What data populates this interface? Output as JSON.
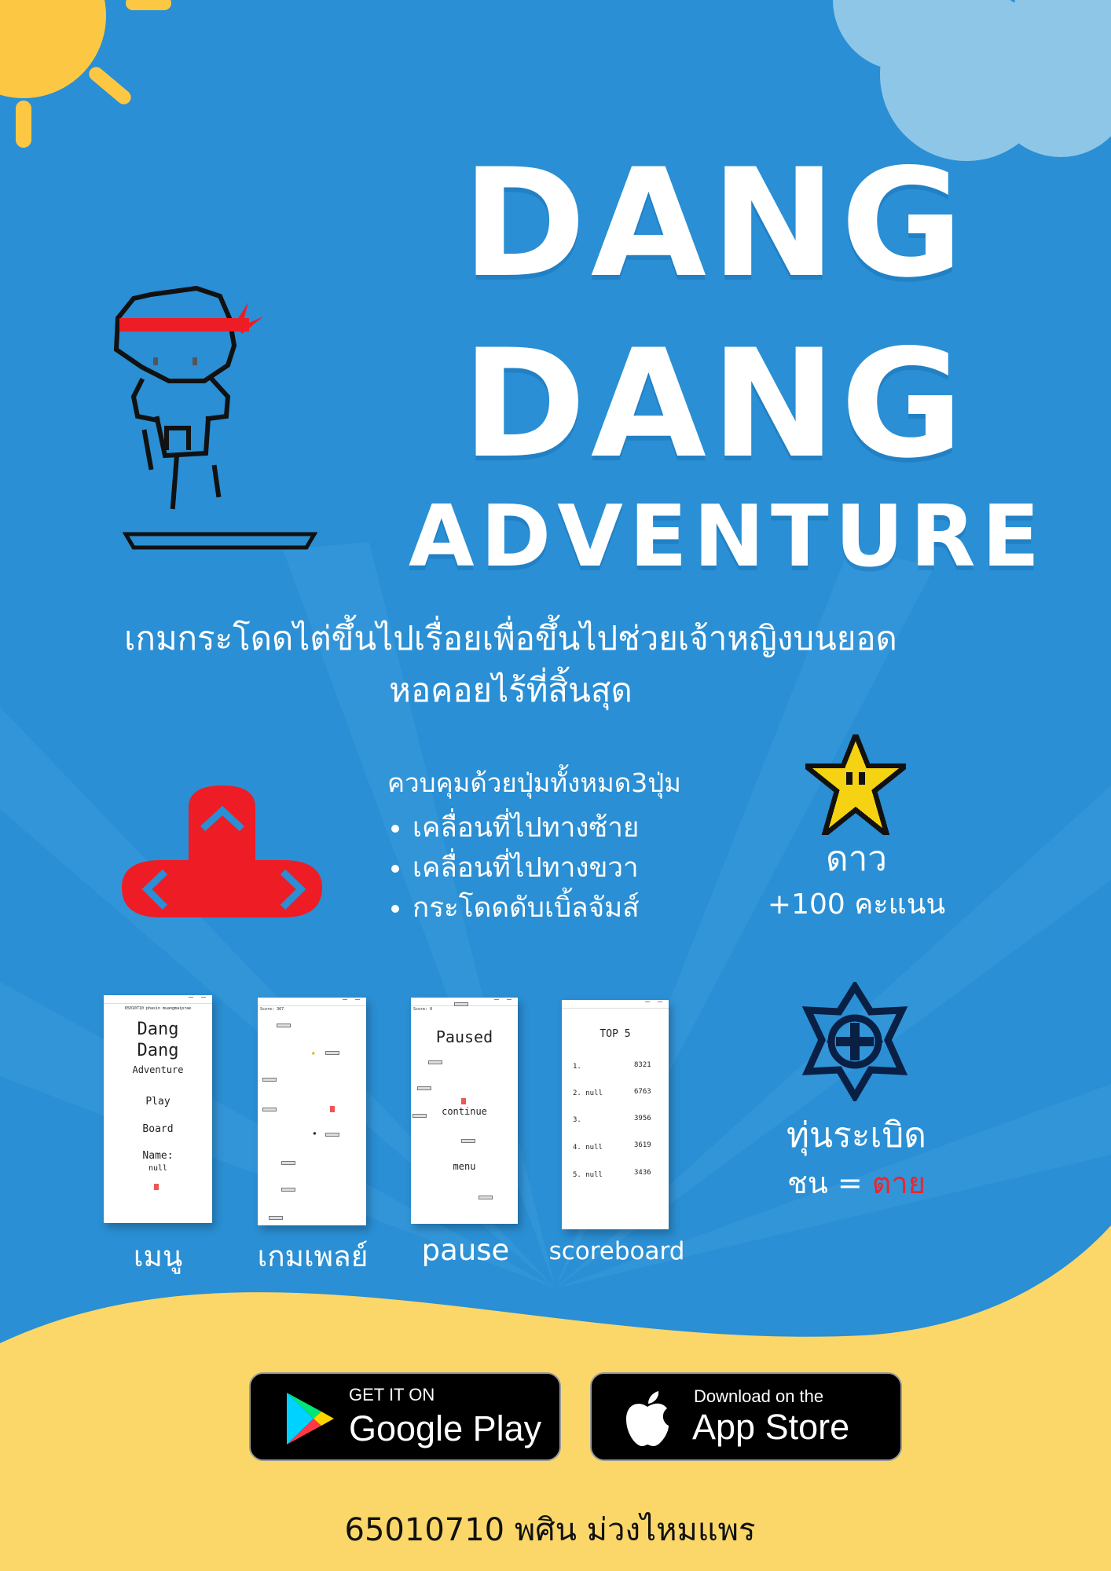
{
  "title": {
    "line1": "DANG",
    "line2": "DANG",
    "line3": "ADVENTURE"
  },
  "tagline": {
    "line1": "เกมกระโดดไต่ขึ้นไปเรื่อยเพื่อขึ้นไปช่วยเจ้าหญิงบนยอด",
    "line2": "หอคอยไร้ที่สิ้นสุด"
  },
  "controls": {
    "heading": "ควบคุมด้วยปุ่มทั้งหมด3ปุ่ม",
    "items": [
      "เคลื่อนที่ไปทางซ้าย",
      "เคลื่อนที่ไปทางขวา",
      "กระโดดดับเบิ้ลจัมส์"
    ]
  },
  "star": {
    "name": "ดาว",
    "score": "+100 คะแนน"
  },
  "bomb": {
    "name": "ทุ่นระเบิด",
    "rule_prefix": "ชน =",
    "rule_result": "ตาย",
    "result_color": "#e8262f"
  },
  "screenshots": [
    {
      "label": "เมนู",
      "student_line": "65010710 phasin muangmaiprae",
      "title1": "Dang",
      "title2": "Dang",
      "title3": "Adventure",
      "play": "Play",
      "board": "Board",
      "name_label": "Name:",
      "name_value": "null"
    },
    {
      "label": "เกมเพลย์",
      "score": "Score: 367"
    },
    {
      "label": "pause",
      "score": "Score: 0",
      "title": "Paused",
      "continue": "continue",
      "menu": "menu"
    },
    {
      "label": "scoreboard",
      "title": "TOP 5",
      "rows": [
        {
          "rank": "1.",
          "score": "8321"
        },
        {
          "rank": "2. null",
          "score": "6763"
        },
        {
          "rank": "3.",
          "score": "3956"
        },
        {
          "rank": "4. null",
          "score": "3619"
        },
        {
          "rank": "5. null",
          "score": "3436"
        }
      ]
    }
  ],
  "stores": {
    "google_small": "GET IT ON",
    "google_big": "Google Play",
    "apple_small": "Download on the",
    "apple_big": "App Store"
  },
  "footer": "65010710 พศิน ม่วงไหมแพร",
  "colors": {
    "sky": "#2a8fd4",
    "sand": "#fbd76a",
    "sun": "#fcc844",
    "cloud": "#8ec6e8",
    "control_red": "#ee1c25",
    "accent_blue": "#2a8fd4"
  }
}
